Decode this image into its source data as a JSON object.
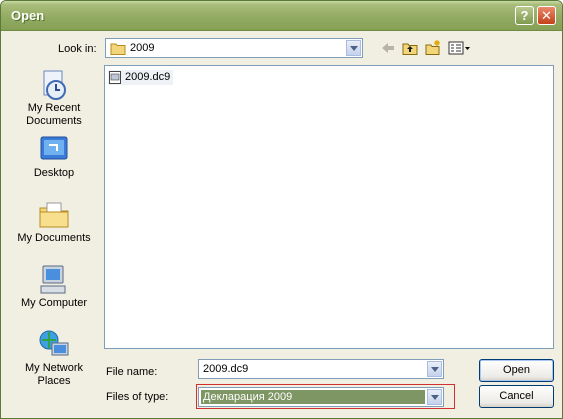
{
  "window": {
    "title": "Open",
    "help": "?",
    "close": "✕"
  },
  "lookin": {
    "label": "Look in:",
    "value": "2009"
  },
  "toolbar": {
    "icons": [
      "back-arrow-icon",
      "up-folder-icon",
      "new-folder-icon",
      "views-menu-icon"
    ]
  },
  "places": [
    {
      "label": "My Recent Documents",
      "icon": "recent-documents-icon"
    },
    {
      "label": "Desktop",
      "icon": "desktop-icon"
    },
    {
      "label": "My Documents",
      "icon": "my-documents-icon"
    },
    {
      "label": "My Computer",
      "icon": "my-computer-icon"
    },
    {
      "label": "My Network Places",
      "icon": "network-places-icon"
    }
  ],
  "files": [
    {
      "name": "2009.dc9"
    }
  ],
  "filename": {
    "label": "File name:",
    "value": "2009.dc9"
  },
  "filetype": {
    "label": "Files of type:",
    "value": "Декларация 2009"
  },
  "buttons": {
    "open": "Open",
    "cancel": "Cancel"
  },
  "colors": {
    "titlebar": "#93ab63",
    "dialog_bg": "#f1efe2",
    "highlight_border": "#d03030",
    "selected_field": "#7e9663"
  }
}
